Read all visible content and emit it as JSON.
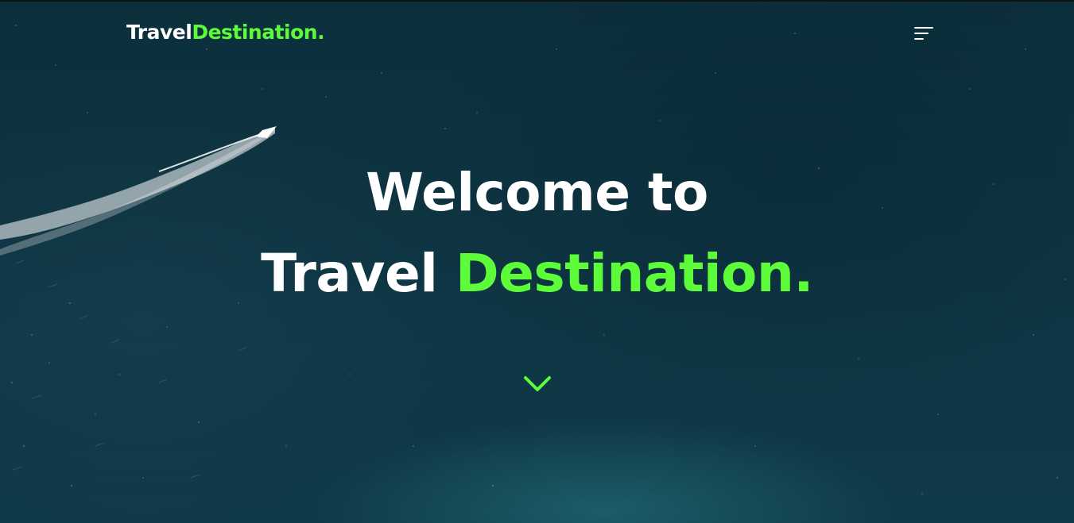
{
  "header": {
    "logo": {
      "part1": "Travel",
      "part2": "Destination."
    },
    "menu_icon": "hamburger-menu-icon"
  },
  "hero": {
    "title_line1": "Welcome to",
    "title_line2_part1": "Travel",
    "title_line2_part2": "Destination.",
    "scroll_icon": "chevron-down-icon"
  },
  "colors": {
    "accent": "#5dfc3b",
    "text": "#ffffff",
    "background": "#0e3442"
  }
}
